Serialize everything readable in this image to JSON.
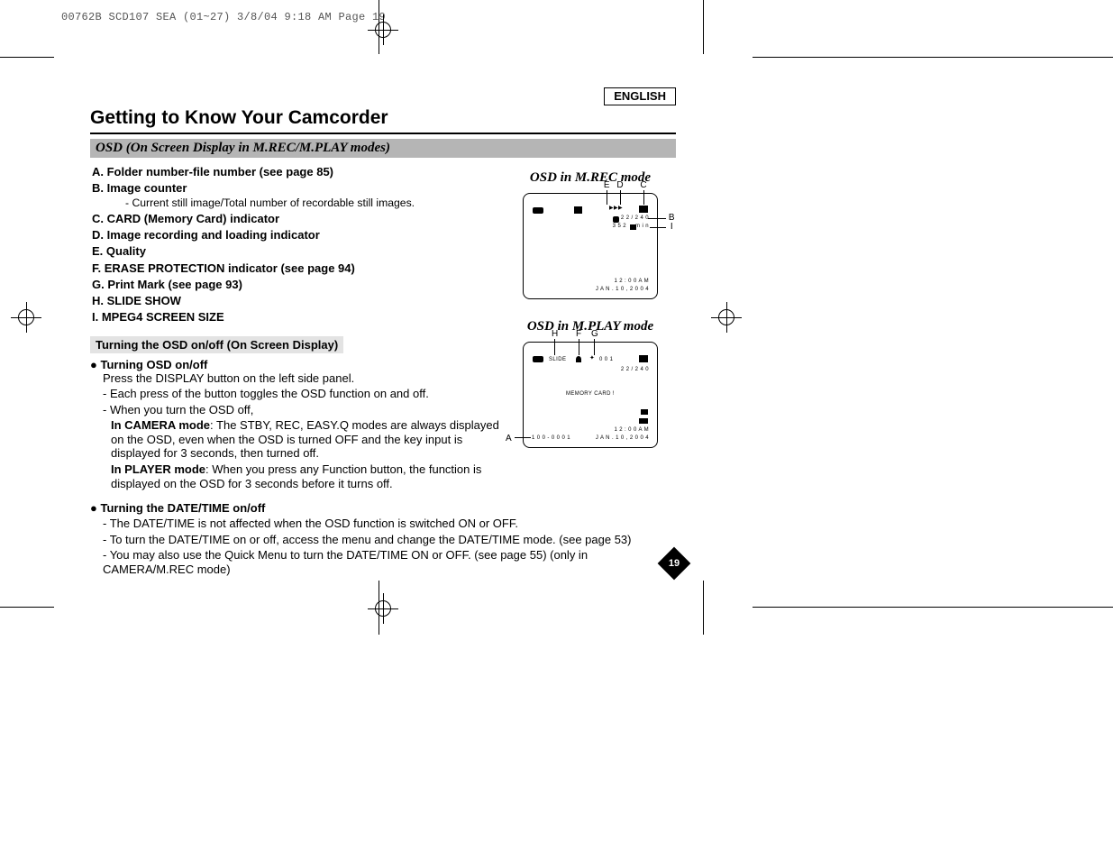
{
  "imposition_header": "00762B SCD107 SEA (01~27)  3/8/04  9:18 AM  Page 19",
  "language_label": "ENGLISH",
  "title": "Getting to Know Your Camcorder",
  "subtitle": "OSD (On Screen Display in M.REC/M.PLAY modes)",
  "defs": {
    "a": "A.  Folder number-file number (see page 85)",
    "b": "B.  Image counter",
    "b_sub": "- Current still image/Total number of recordable still images.",
    "c": "C.  CARD (Memory Card) indicator",
    "d": "D.  Image recording and loading indicator",
    "e": "E.  Quality",
    "f": "F.  ERASE PROTECTION indicator (see page 94)",
    "g": "G.  Print Mark (see page 93)",
    "h": "H.  SLIDE SHOW",
    "i": "I.   MPEG4 SCREEN SIZE"
  },
  "turning_header": "Turning the OSD on/off (On Screen Display)",
  "osd_onoff_bullet": "● Turning OSD on/off",
  "osd_p1": "Press the DISPLAY button on the left side panel.",
  "osd_p2": "- Each press of the button toggles the OSD function on and off.",
  "osd_p3": "- When you turn the OSD off,",
  "osd_cam_bold": "In CAMERA mode",
  "osd_cam_rest": ": The STBY, REC, EASY.Q modes are always displayed on the OSD, even when the OSD is turned OFF and the key input is displayed for 3 seconds, then turned off.",
  "osd_ply_bold": "In PLAYER mode",
  "osd_ply_rest": ": When you press any Function button, the function is displayed on the OSD for 3 seconds before it turns off.",
  "dt_bullet": "● Turning the DATE/TIME on/off",
  "dt_p1": "- The DATE/TIME is not affected when the OSD function is switched ON or OFF.",
  "dt_p2": "- To turn the DATE/TIME on or off, access the menu and change the DATE/TIME mode. (see page 53)",
  "dt_p3": "- You may also use the Quick Menu to turn the DATE/TIME ON or OFF. (see page 55) (only in CAMERA/M.REC mode)",
  "diagrams": {
    "mrec_title": "OSD in M.REC mode",
    "mplay_title": "OSD in M.PLAY mode",
    "callouts": {
      "A": "A",
      "B": "B",
      "C": "C",
      "D": "D",
      "E": "E",
      "F": "F",
      "G": "G",
      "H": "H",
      "I": "I"
    },
    "mrec": {
      "counter": "2 2 / 2 4 0",
      "size": "3 5 2",
      "qual_suffix": "m i n",
      "time": "1 2 : 0 0 A M",
      "date": "J A N . 1 0 , 2 0 0 4"
    },
    "mplay": {
      "slide": "SLIDE",
      "print": "0 0 1",
      "counter": "2 2 / 2 4 0",
      "card": "MEMORY CARD !",
      "folder": "1 0 0 - 0 0 0 1",
      "time": "1 2 : 0 0 A M",
      "date": "J A N . 1 0 , 2 0 0 4"
    }
  },
  "page_number": "19"
}
